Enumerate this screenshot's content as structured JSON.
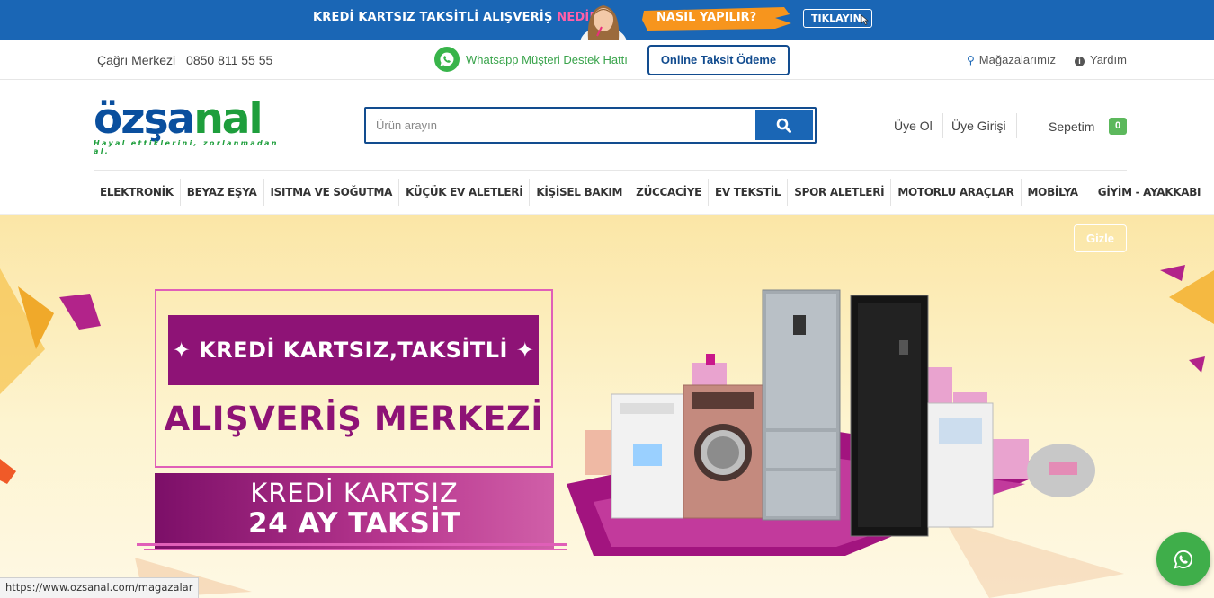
{
  "promo": {
    "text_main": "KREDİ KARTSIZ TAKSİTLİ ALIŞVERİŞ",
    "text_accent": "NEDİR?",
    "how": "NASIL YAPILIR?",
    "cta": "TIKLAYIN"
  },
  "topbar": {
    "call_label": "Çağrı Merkezi",
    "call_number": "0850 811 55 55",
    "whatsapp": "Whatsapp Müşteri Destek Hattı",
    "online_payment": "Online Taksit Ödeme",
    "stores": "Mağazalarımız",
    "help": "Yardım"
  },
  "header": {
    "logo_main_a": "özşa",
    "logo_main_b": "nal",
    "logo_tagline": "Hayal ettiklerini, zorlanmadan al.",
    "search_placeholder": "Ürün arayın",
    "register": "Üye Ol",
    "login": "Üye Girişi",
    "cart_label": "Sepetim",
    "cart_count": "0"
  },
  "nav": [
    "ELEKTRONİK",
    "BEYAZ EŞYA",
    "ISITMA VE SOĞUTMA",
    "KÜÇÜK EV ALETLERİ",
    "KİŞİSEL BAKIM",
    "ZÜCCACİYE",
    "EV TEKSTİL",
    "SPOR ALETLERİ",
    "MOTORLU ARAÇLAR",
    "MOBİLYA",
    "GİYİM - AYAKKABI"
  ],
  "hero": {
    "hide": "Gizle",
    "title1": "✦ KREDİ KARTSIZ,TAKSİTLİ ✦",
    "title2": "ALIŞVERİŞ MERKEZİ",
    "line1": "KREDİ KARTSIZ",
    "line2": "24 AY TAKSİT"
  },
  "status_url": "https://www.ozsanal.com/magazalar",
  "colors": {
    "brand_blue": "#1a66b5",
    "dark_blue": "#124c8f",
    "brand_green": "#1e9e3c",
    "whatsapp_green": "#3fae4a",
    "hero_purple": "#8e1376",
    "hero_pink": "#e05fb8"
  }
}
